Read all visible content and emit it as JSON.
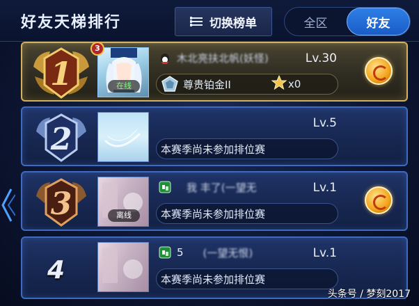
{
  "header": {
    "title": "好友天梯排行",
    "switch_label": "切换榜单",
    "tabs": [
      {
        "label": "全区",
        "active": false
      },
      {
        "label": "好友",
        "active": true
      }
    ]
  },
  "rows": [
    {
      "rank": "1",
      "level_badge": "3",
      "avatar_status": "在线",
      "name": "木北亮扶北帆(妖怪)",
      "level": "Lv.30",
      "tier": "尊贵铂金II",
      "stars": "x0",
      "has_action": true
    },
    {
      "rank": "2",
      "name": "",
      "level": "Lv.5",
      "tier": "本赛季尚未参加排位赛",
      "has_action": false
    },
    {
      "rank": "3",
      "avatar_status": "离线",
      "name": "我  丰了(一望无",
      "level": "Lv.1",
      "tier": "本赛季尚未参加排位赛",
      "has_action": true
    },
    {
      "rank": "4",
      "name_prefix": "5",
      "name": "(一望无恨)",
      "level": "Lv.1",
      "tier": "本赛季尚未参加排位赛",
      "has_action": false
    }
  ],
  "watermark": "头条号 / 梦刻2017",
  "colors": {
    "gold": "#d4b25c",
    "blue_border": "#3e6ac0",
    "tab_active": "#2e7fe6"
  }
}
